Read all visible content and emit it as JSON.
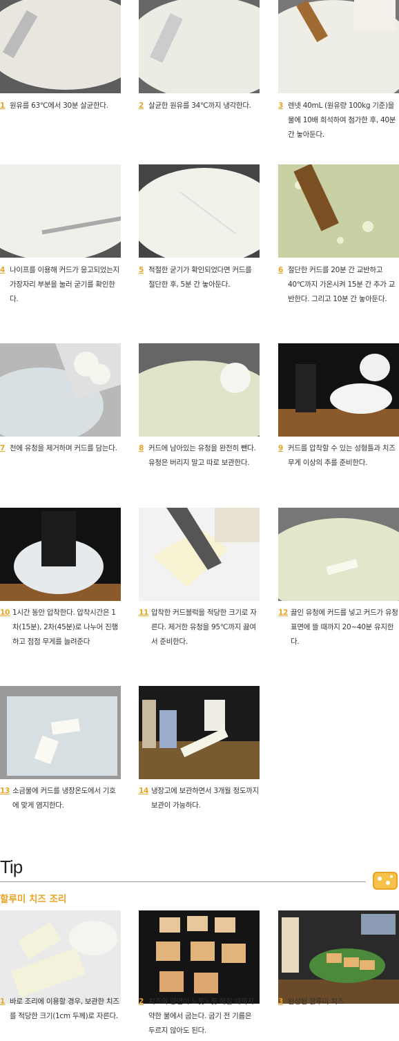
{
  "steps": [
    {
      "num": "1",
      "text": "원유를 63℃에서 30분 살균한다."
    },
    {
      "num": "2",
      "text": "살균한 원유를 34℃까지 냉각한다."
    },
    {
      "num": "3",
      "text": "렌넷 40mL (원유량 100kg 기준)을 물에 10배 희석하여 첨가한 후, 40분 간 놓아둔다."
    },
    {
      "num": "4",
      "text": "나이프를 이용해 커드가 응고되었는지 가장자리 부분을 눌러 굳기를 확인한다."
    },
    {
      "num": "5",
      "text": "적절한 굳기가 확인되었다면 커드를 절단한 후, 5분 간 놓아둔다."
    },
    {
      "num": "6",
      "text": "절단한 커드를 20분 간 교반하고 40℃까지 가온시켜 15분 간 추가 교반한다. 그리고 10분 간 놓아둔다."
    },
    {
      "num": "7",
      "text": "천에 유청을 제거하며 커드를 담는다."
    },
    {
      "num": "8",
      "text": "커드에 남아있는 유청을 완전히 뺀다. 유청은 버리지 말고 따로 보관한다."
    },
    {
      "num": "9",
      "text": "커드를 압착할 수 있는 성형틀과 치즈 무게 이상의 추를 준비한다."
    },
    {
      "num": "10",
      "text": "1시간 동안 압착한다. 압착시간은 1차(15분), 2차(45분)로 나누어 진행하고 점점 무게를 늘려준다"
    },
    {
      "num": "11",
      "text": "압착한 커드블럭을 적당한 크기로 자른다. 제거한 유청을 95℃까지 끓여서 준비한다."
    },
    {
      "num": "12",
      "text": "끓인 유청에 커드를 넣고 커드가 유청 표면에 뜰 때까지 20~40분 유지한다."
    },
    {
      "num": "13",
      "text": "소금물에 커드를 냉장온도에서 기호에 맞게 염지한다."
    },
    {
      "num": "14",
      "text": "냉장고에 보관하면서 3개월 정도까지 보관이 가능하다."
    }
  ],
  "tip": {
    "title": "Tip",
    "subtitle": "할루미 치즈 조리",
    "steps": [
      {
        "num": "1",
        "text": "바로 조리에 이용할 경우, 보관한 치즈를 적당한 크기(1cm 두께)로 자른다."
      },
      {
        "num": "2",
        "text": "치즈의 양면이 노릇노릇 해질 때까지 약한 불에서 굽는다. 굽기 전 기름은 두르지 않아도 된다."
      },
      {
        "num": "3",
        "text": "완성된 할루미 치즈"
      }
    ]
  },
  "colors": {
    "accent": "#e8a324",
    "text": "#333333"
  }
}
